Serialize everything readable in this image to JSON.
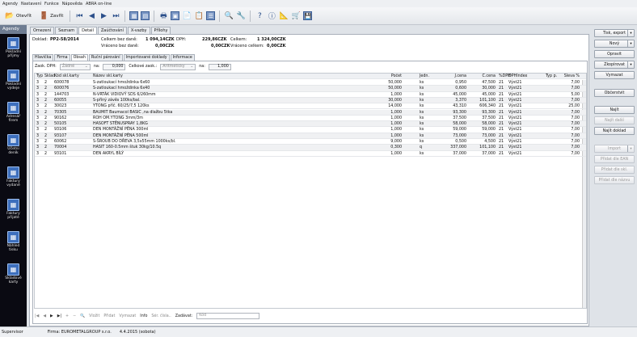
{
  "menu": [
    "Agendy",
    "Nastavení",
    "Funkce",
    "Nápověda",
    "ABRA on-line"
  ],
  "toolbar": {
    "open": "Otevřít",
    "close": "Zavřít",
    "icons": [
      "first-icon",
      "prev-icon",
      "next-icon",
      "last-icon",
      "calc-icon",
      "calc2-icon",
      "print-icon",
      "doc-icon",
      "copy-icon",
      "new-doc-icon",
      "list-icon",
      "search-icon",
      "filter-icon",
      "help-icon",
      "info-icon",
      "ruler-icon",
      "cart-icon",
      "save-icon"
    ]
  },
  "sidebar": {
    "title": "Agendy",
    "items": [
      {
        "label": "Pokladní\npříjmy",
        "icon": "cash-in-icon"
      },
      {
        "label": "Pokladní\nvýdeje",
        "icon": "cash-out-icon"
      },
      {
        "label": "Adresář\nfirem",
        "icon": "address-book-icon"
      },
      {
        "label": "Účetní\ndeník",
        "icon": "ledger-icon"
      },
      {
        "label": "Faktury\nvydané",
        "icon": "invoice-out-icon"
      },
      {
        "label": "Faktury\npřijaté",
        "icon": "invoice-in-icon"
      },
      {
        "label": "Náhled\ntisku",
        "icon": "print-preview-icon"
      },
      {
        "label": "Skladové\nkarty",
        "icon": "stock-cards-icon"
      }
    ]
  },
  "tabs": [
    "Omezení",
    "Seznam",
    "Detail",
    "Zaúčtování",
    "X-vazby",
    "Přílohy"
  ],
  "active_tab": "Detail",
  "header": {
    "doklad_label": "Doklad:",
    "doklad": "PP2-58/2014",
    "celkem_bez_dph_label": "Celkem bez daně:",
    "celkem_bez_dph": "1 094,14CZK",
    "dph_label": "DPH:",
    "dph": "229,86CZK",
    "celkem_label": "Celkem:",
    "celkem": "1 324,00CZK",
    "vraceno_bez_label": "Vráceno bez daně:",
    "vraceno_bez": "0,00CZK",
    "vraceno_dph": "0,00CZK",
    "vraceno_celkem_label": "Vráceno celkem:",
    "vraceno_celkem": "0,00CZK"
  },
  "subtabs": [
    "Hlavička",
    "Firma",
    "Obsah",
    "Ruční párování",
    "Importované doklady",
    "Informace"
  ],
  "active_subtab": "Obsah",
  "filter": {
    "zaokr_label": "Zaok. DPH:",
    "zaokr_value": "Žádné",
    "na_label": "na:",
    "na_value": "0,000",
    "celk_label": "Celkové zaok.:",
    "celk_value": "Aritmeticky",
    "na2_label": "na:",
    "na2_value": "1,000"
  },
  "columns": [
    "Typ",
    "Sklad",
    "Kód skl.karty",
    "Název skl.karty",
    "Počet",
    "Jedn.",
    "J.cena",
    "C.cena",
    "%DPH",
    "DPHIndex",
    "Typ p.",
    "Sleva %"
  ],
  "rows": [
    [
      "3",
      "2",
      "600078",
      "S-zatloukací hmoždinka 6x60",
      "50,000",
      "ks",
      "0,950",
      "47,500",
      "21",
      "Výst21",
      "",
      "7,00"
    ],
    [
      "3",
      "2",
      "600076",
      "S-zatloukací hmoždinka 6x40",
      "50,000",
      "ks",
      "0,600",
      "30,000",
      "21",
      "Výst21",
      "",
      "7,00"
    ],
    [
      "3",
      "2",
      "144703",
      "N-VRTÁK VIDIOVÝ SDS 6/260mm",
      "1,000",
      "ks",
      "45,000",
      "45,000",
      "21",
      "Výst21",
      "",
      "5,00"
    ],
    [
      "3",
      "2",
      "60055",
      "S-příný závěs 100ks/bal.",
      "30,000",
      "ks",
      "3,370",
      "101,100",
      "21",
      "Výst21",
      "",
      "7,00"
    ],
    [
      "3",
      "2",
      "30023",
      "YTONG příč. 60/25/7,5  120ks",
      "14,000",
      "ks",
      "43,310",
      "606,340",
      "21",
      "Výst21",
      "",
      "25,00"
    ],
    [
      "3",
      "2",
      "70305",
      "BAUMIT Baumacol BASIC ,na dlažbu 5tka",
      "1,000",
      "ks",
      "93,300",
      "93,300",
      "21",
      "Výst21",
      "",
      "7,00"
    ],
    [
      "3",
      "2",
      "90162",
      "ROH OM.YTONG 3mm/3m",
      "1,000",
      "ks",
      "37,500",
      "37,500",
      "21",
      "Výst21",
      "",
      "7,00"
    ],
    [
      "3",
      "2",
      "50105",
      "HASOFT STĚNUSPRAY 1,8KG",
      "1,000",
      "ks",
      "58,000",
      "58,000",
      "21",
      "Výst21",
      "",
      "7,00"
    ],
    [
      "3",
      "2",
      "93106",
      "DEN MONTÁŽNÍ PĚNA 300ml",
      "1,000",
      "ks",
      "59,000",
      "59,000",
      "21",
      "Výst21",
      "",
      "7,00"
    ],
    [
      "3",
      "2",
      "93107",
      "DEN MONTÁŽNÍ PĚNA 500ml",
      "1,000",
      "ks",
      "73,000",
      "73,000",
      "21",
      "Výst21",
      "",
      "7,00"
    ],
    [
      "3",
      "2",
      "60062",
      "S-ŠROUB DO DŘEVA 3,5x55mm 1000ks/bl.",
      "9,000",
      "ks",
      "0,500",
      "4,500",
      "21",
      "Výst21",
      "",
      "7,00"
    ],
    [
      "3",
      "2",
      "70004",
      "HASIT 160-0.5mm štuk 30kg/10.5q",
      "0,300",
      "q",
      "337,000",
      "101,100",
      "21",
      "Výst21",
      "",
      "7,00"
    ],
    [
      "3",
      "2",
      "93101",
      "DEN AKRYL BÍLÝ",
      "1,000",
      "ks",
      "37,000",
      "37,000",
      "21",
      "Výst21",
      "",
      "7,00"
    ]
  ],
  "navbar": {
    "vlozit": "Vložit",
    "pridat": "Přidat",
    "vymazat": "Vymazat",
    "info": "Info",
    "ser_cisla": "Sér. čísla..",
    "zadavat_label": "Zadávat:",
    "zadavat_value": "Kód"
  },
  "right": {
    "tisk": "Tisk, export",
    "novy": "Nový",
    "opravit": "Opravit",
    "zkopirovat": "Zkopírovat",
    "vymazat": "Vymazat",
    "obcerstvit": "Občerstvit",
    "najit": "Najít",
    "najit_dalsi": "Najít další",
    "najit_doklad": "Najít doklad",
    "import": "Import",
    "pridat_ean": "Přidat dle EAN",
    "pridat_skl": "Přidat dle skl.",
    "pridat_nazvu": "Přidat dle názvu"
  },
  "status": {
    "user": "Supervisor",
    "firma": "Firma: EUROMETALGROUP s.r.o.",
    "date": "4.4.2015 (sobota)"
  }
}
